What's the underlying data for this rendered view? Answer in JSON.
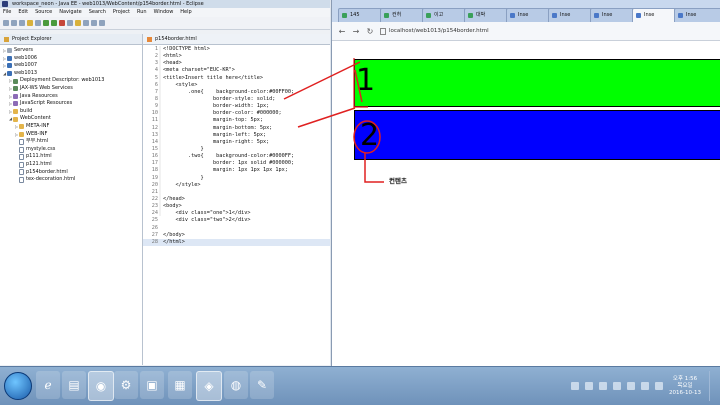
{
  "eclipse": {
    "title": "workspace_neon - Java EE - web1013/WebContent/p154border.html - Eclipse",
    "menu": [
      "File",
      "Edit",
      "Source",
      "Navigate",
      "Search",
      "Project",
      "Run",
      "Window",
      "Help"
    ],
    "explorer_tab": "Project Explorer",
    "tree": [
      {
        "label": "Servers",
        "indent": 0,
        "arrow": "▷",
        "icon": "server"
      },
      {
        "label": "web1006",
        "indent": 0,
        "arrow": "▷",
        "icon": "project"
      },
      {
        "label": "web1007",
        "indent": 0,
        "arrow": "▷",
        "icon": "project"
      },
      {
        "label": "web1013",
        "indent": 0,
        "arrow": "◢",
        "icon": "project"
      },
      {
        "label": "Deployment Descriptor: web1013",
        "indent": 1,
        "arrow": "▷",
        "icon": "descr"
      },
      {
        "label": "JAX-WS Web Services",
        "indent": 1,
        "arrow": "▷",
        "icon": "descr"
      },
      {
        "label": "Java Resources",
        "indent": 1,
        "arrow": "▷",
        "icon": "lib"
      },
      {
        "label": "JavaScript Resources",
        "indent": 1,
        "arrow": "▷",
        "icon": "lib"
      },
      {
        "label": "build",
        "indent": 1,
        "arrow": "▷",
        "icon": "folder"
      },
      {
        "label": "WebContent",
        "indent": 1,
        "arrow": "◢",
        "icon": "folder"
      },
      {
        "label": "META-INF",
        "indent": 2,
        "arrow": "▷",
        "icon": "folder"
      },
      {
        "label": "WEB-INF",
        "indent": 2,
        "arrow": "▷",
        "icon": "folder"
      },
      {
        "label": "부부.html",
        "indent": 2,
        "arrow": "",
        "icon": "file"
      },
      {
        "label": "mystyle.css",
        "indent": 2,
        "arrow": "",
        "icon": "file"
      },
      {
        "label": "p111.html",
        "indent": 2,
        "arrow": "",
        "icon": "file"
      },
      {
        "label": "p121.html",
        "indent": 2,
        "arrow": "",
        "icon": "file"
      },
      {
        "label": "p154border.html",
        "indent": 2,
        "arrow": "",
        "icon": "file"
      },
      {
        "label": "tex-decoration.html",
        "indent": 2,
        "arrow": "",
        "icon": "file"
      }
    ],
    "editor_tab": "p154border.html",
    "code_lines": [
      "<!DOCTYPE html>",
      "<html>",
      "<head>",
      "<meta charset=\"EUC-KR\">",
      "<title>Insert title here</title>",
      "    <style>",
      "        .one{    background-color:#00FF00;",
      "                border-style: solid;",
      "                border-width: 1px;",
      "                border-color: #000000;",
      "                margin-top: 5px;",
      "                margin-bottom: 5px;",
      "                margin-left: 5px;",
      "                margin-right: 5px;",
      "            }",
      "        .two{    background-color:#0000FF;",
      "                border: 1px solid #000000;",
      "                margin: 1px 1px 1px 1px;",
      "            }",
      "    </style>",
      "",
      "</head>",
      "<body>",
      "    <div class=\"one\">1</div>",
      "    <div class=\"two\">2</div>",
      "",
      "</body>",
      "</html>"
    ]
  },
  "chrome": {
    "tabs": [
      {
        "label": "145",
        "active": false
      },
      {
        "label": "컨허",
        "active": false
      },
      {
        "label": "이고",
        "active": false
      },
      {
        "label": "대박",
        "active": false
      },
      {
        "label": "Inse",
        "active": false
      },
      {
        "label": "Inse",
        "active": false
      },
      {
        "label": "Inse",
        "active": false
      },
      {
        "label": "Inse",
        "active": true
      },
      {
        "label": "Inse",
        "active": false
      }
    ],
    "back": "←",
    "forward": "→",
    "reload": "↻",
    "url": "localhost/web1013/p154border.html",
    "box_one_text": "1",
    "box_two_text": "2",
    "annotation_label": "컨텐츠",
    "box_one_color": "#00ff00",
    "box_two_color": "#0000ff",
    "annotation_color": "#e02020"
  },
  "taskbar": {
    "apps": [
      "ie-icon",
      "folder-icon",
      "chrome-icon",
      "tool-icon",
      "window-icon",
      "photos-icon",
      "game-icon",
      "network-icon",
      "paint-icon"
    ],
    "clock_time": "오후 1:56",
    "clock_day": "목요일",
    "clock_date": "2016-10-13"
  }
}
